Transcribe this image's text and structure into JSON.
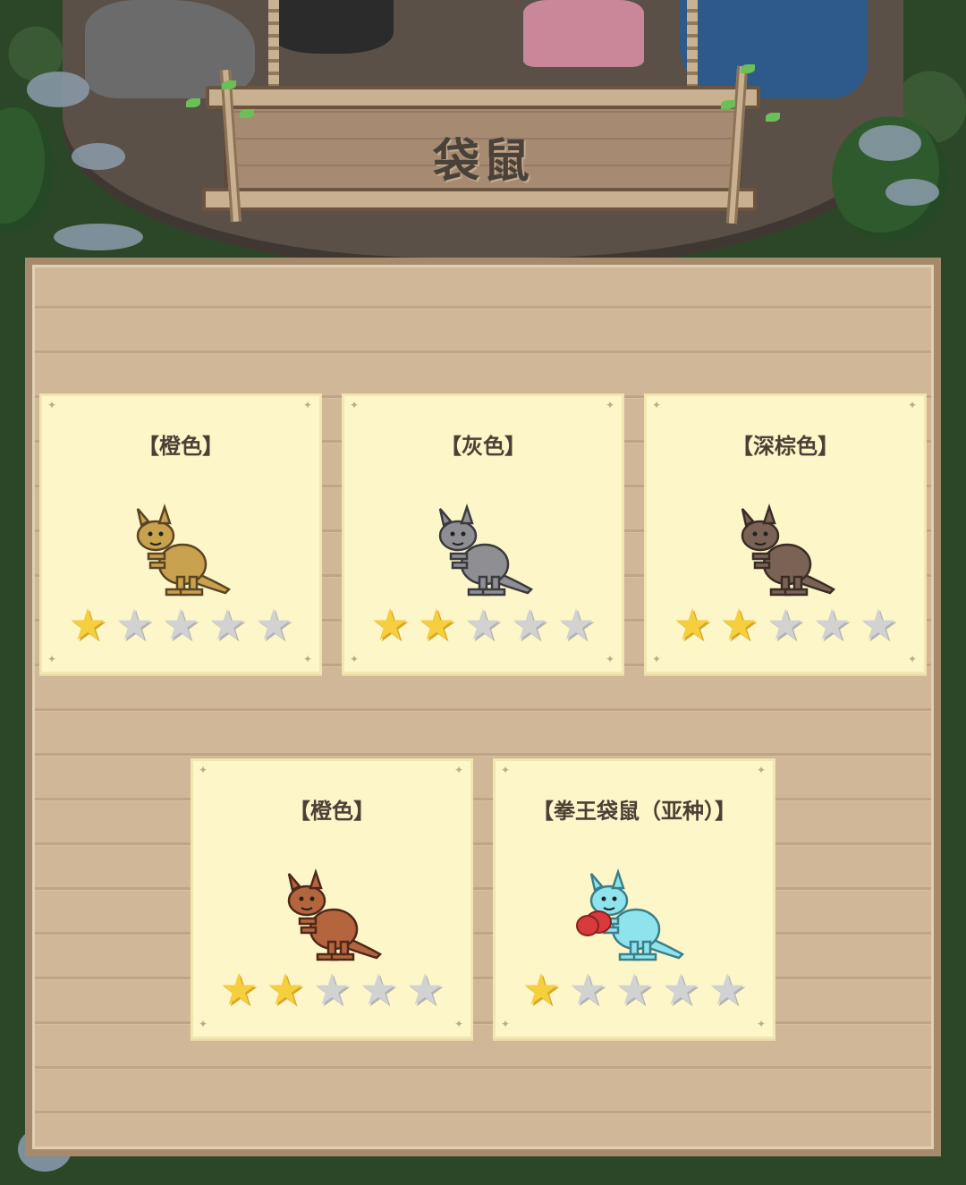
{
  "sign": {
    "title": "袋鼠"
  },
  "cards": [
    {
      "label": "【橙色】",
      "color": "#c9a24f",
      "outline": "#5a4424",
      "stars": 1,
      "max_stars": 5,
      "boxing": false
    },
    {
      "label": "【灰色】",
      "color": "#8f8f93",
      "outline": "#3a3a40",
      "stars": 2,
      "max_stars": 5,
      "boxing": false
    },
    {
      "label": "【深棕色】",
      "color": "#7a6354",
      "outline": "#3a2d25",
      "stars": 2,
      "max_stars": 5,
      "boxing": false
    },
    {
      "label": "【橙色】",
      "color": "#b5653e",
      "outline": "#4e2818",
      "stars": 2,
      "max_stars": 5,
      "boxing": false
    },
    {
      "label": "【拳王袋鼠（亚种）】",
      "color": "#8fe3ec",
      "outline": "#3a7f8a",
      "stars": 1,
      "max_stars": 5,
      "boxing": true,
      "glove_color": "#d63a3a"
    }
  ],
  "icons": {
    "star_filled": "star-filled-icon",
    "star_empty": "star-empty-icon",
    "corner": "corner-pin-icon"
  }
}
